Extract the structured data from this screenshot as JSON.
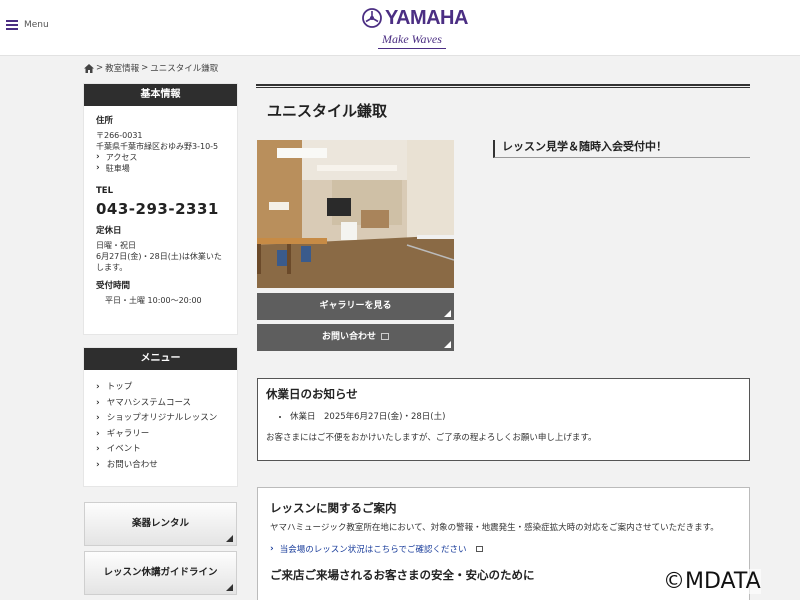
{
  "header": {
    "menu_label": "Menu",
    "logo_text": "YAMAHA",
    "logo_tagline": "Make Waves",
    "brand_color": "#4b2e83"
  },
  "breadcrumb": {
    "items": [
      "教室情報",
      "ユニスタイル鎌取"
    ],
    "separator": ">"
  },
  "sidebar": {
    "basic": {
      "heading": "基本情報",
      "address_label": "住所",
      "postal": "〒266-0031",
      "address": "千葉県千葉市緑区おゆみ野3-10-5",
      "links": [
        "アクセス",
        "駐車場"
      ],
      "tel_label": "TEL",
      "tel": "043-293-2331",
      "closed_label": "定休日",
      "closed": "日曜・祝日",
      "closed_note": "6月27日(金)・28日(土)は休業いたします。",
      "hours_label": "受付時間",
      "hours": "平日・土曜 10:00～20:00"
    },
    "menu": {
      "heading": "メニュー",
      "items": [
        "トップ",
        "ヤマハシステムコース",
        "ショップオリジナルレッスン",
        "ギャラリー",
        "イベント",
        "お問い合わせ"
      ]
    },
    "rental_label": "楽器レンタル",
    "guideline_label": "レッスン休講ガイドライン"
  },
  "main": {
    "title": "ユニスタイル鎌取",
    "gallery_button": "ギャラリーを見る",
    "contact_button": "お問い合わせ",
    "notice_heading": "レッスン見学＆随時入会受付中！",
    "holiday": {
      "title": "休業日のお知らせ",
      "item": "休業日　2025年6月27日(金)・28日(土)",
      "text": "お客さまにはご不便をおかけいたしますが、ご了承の程よろしくお願い申し上げます。"
    },
    "lesson": {
      "title": "レッスンに関するご案内",
      "text": "ヤマハミュージック教室所在地において、対象の警報・地震発生・感染症拡大時の対応をご案内させていただきます。",
      "link": "当会場のレッスン状況はこちらでご確認ください",
      "title2": "ご来店ご来場されるお客さまの安全・安心のために"
    }
  },
  "watermark": "©MDATA"
}
